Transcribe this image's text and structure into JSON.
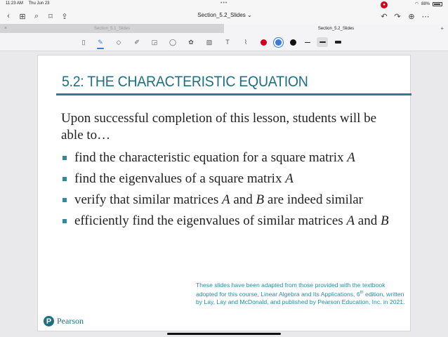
{
  "status": {
    "time": "11:23 AM",
    "date": "Thu Jun 23",
    "dots": "•••",
    "battery": "88%"
  },
  "nav": {
    "title": "Section_5.2_Slides ⌄"
  },
  "tabs": [
    {
      "label": "Section_5.1_Slides"
    },
    {
      "label": "Section_5.2_Slides"
    }
  ],
  "colors": {
    "swatches": [
      "#d0021b",
      "#3c7ad6",
      "#111111"
    ],
    "accent": "#1f6f83"
  },
  "slide": {
    "title": "5.2: THE CHARACTERISTIC EQUATION",
    "intro": "Upon successful completion of this lesson, students will be able to…",
    "bullets": [
      {
        "text": "find the characteristic equation for a square matrix ",
        "var": "A"
      },
      {
        "text": "find the eigenvalues of a square matrix ",
        "var": "A"
      },
      {
        "pre": "verify that similar matrices ",
        "a": "A",
        "mid": " and ",
        "b": "B",
        "post": " are indeed similar"
      },
      {
        "pre": "efficiently find the eigenvalues of similar matrices ",
        "a": "A",
        "mid": " and ",
        "b": "B"
      }
    ],
    "credit": {
      "line1": "These slides have been adapted from those provided with the textbook adopted for this course, Linear Algebra and Its Applications, 6",
      "sup": "th",
      "line2": " edition, written by Lay, Lay and McDonald, and published by Pearson Education, Inc. in 2021."
    },
    "logo": {
      "mark": "P",
      "word": "Pearson"
    }
  }
}
